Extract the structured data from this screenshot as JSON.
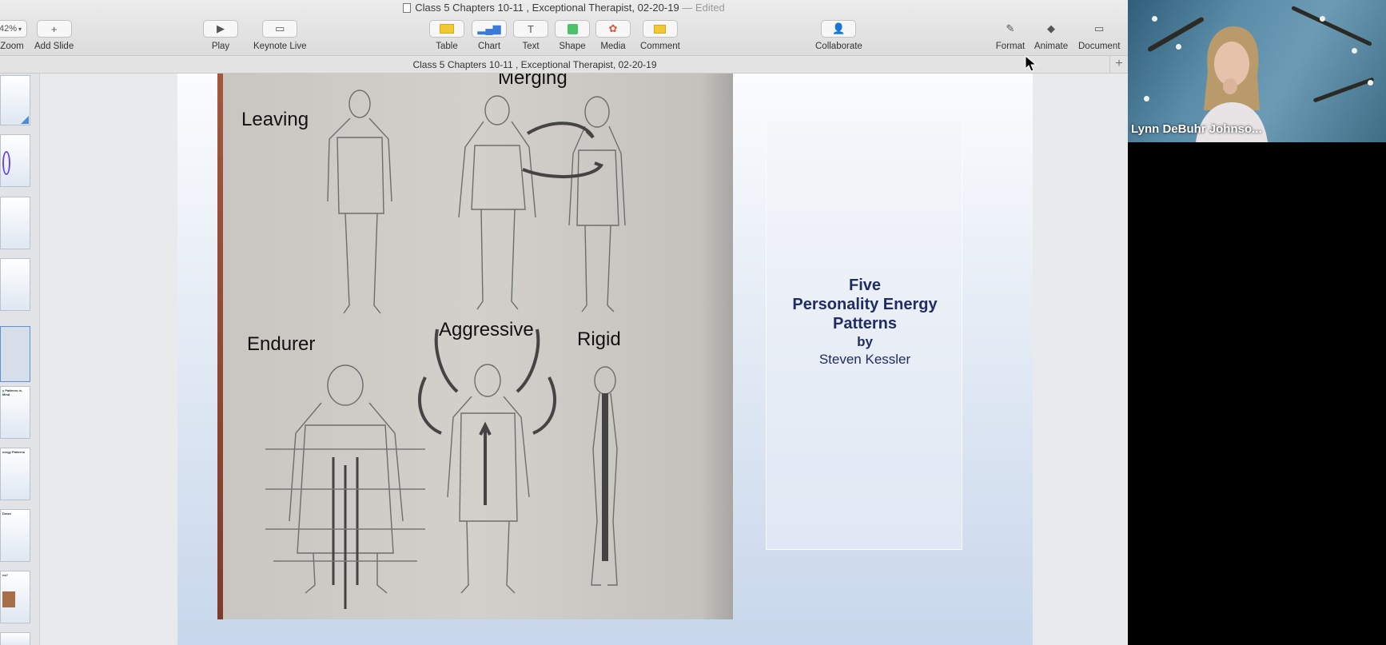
{
  "window": {
    "title": "Class 5 Chapters 10-11 , Exceptional Therapist, 02-20-19",
    "edited": "— Edited"
  },
  "toolbar": {
    "zoom_value": "42%",
    "zoom_label": "Zoom",
    "add_slide": "Add Slide",
    "play": "Play",
    "keynote_live": "Keynote Live",
    "table": "Table",
    "chart": "Chart",
    "text": "Text",
    "shape": "Shape",
    "media": "Media",
    "comment": "Comment",
    "collaborate": "Collaborate",
    "format": "Format",
    "animate": "Animate",
    "document": "Document"
  },
  "tabbar": {
    "title": "Class 5 Chapters 10-11 , Exceptional Therapist, 02-20-19",
    "add": "+"
  },
  "navigator": {
    "thumbs": [
      {
        "text": ""
      },
      {
        "text": ""
      },
      {
        "text": ""
      },
      {
        "text": ""
      },
      {
        "text": ""
      },
      {
        "text": "y Patterns\nis, Mind"
      },
      {
        "text": "nergy Patterns"
      },
      {
        "text": "Down"
      },
      {
        "text": "ns?"
      },
      {
        "text": ""
      }
    ]
  },
  "slide": {
    "photo_labels": {
      "leaving": "Leaving",
      "merging": "Merging",
      "endurer": "Endurer",
      "aggressive": "Aggressive",
      "rigid": "Rigid"
    },
    "textbox": {
      "line1": "Five",
      "line2": "Personality Energy",
      "line3": "Patterns",
      "line4": "by",
      "line5": "Steven Kessler"
    }
  },
  "video": {
    "participant_name": "Lynn DeBuhr Johnso..."
  },
  "colors": {
    "slide_text": "#1f2d63",
    "toolbar_bg": "#e4e4e4",
    "video_bg": "#3b6c86"
  },
  "icons": {
    "play": "play-icon",
    "keynote_live": "keynote-live-icon",
    "table": "table-icon",
    "chart": "chart-icon",
    "text": "text-icon",
    "shape": "shape-icon",
    "media": "media-icon",
    "comment": "comment-icon",
    "collaborate": "collaborate-icon",
    "format": "format-brush-icon",
    "animate": "animate-diamond-icon",
    "document": "document-icon"
  }
}
